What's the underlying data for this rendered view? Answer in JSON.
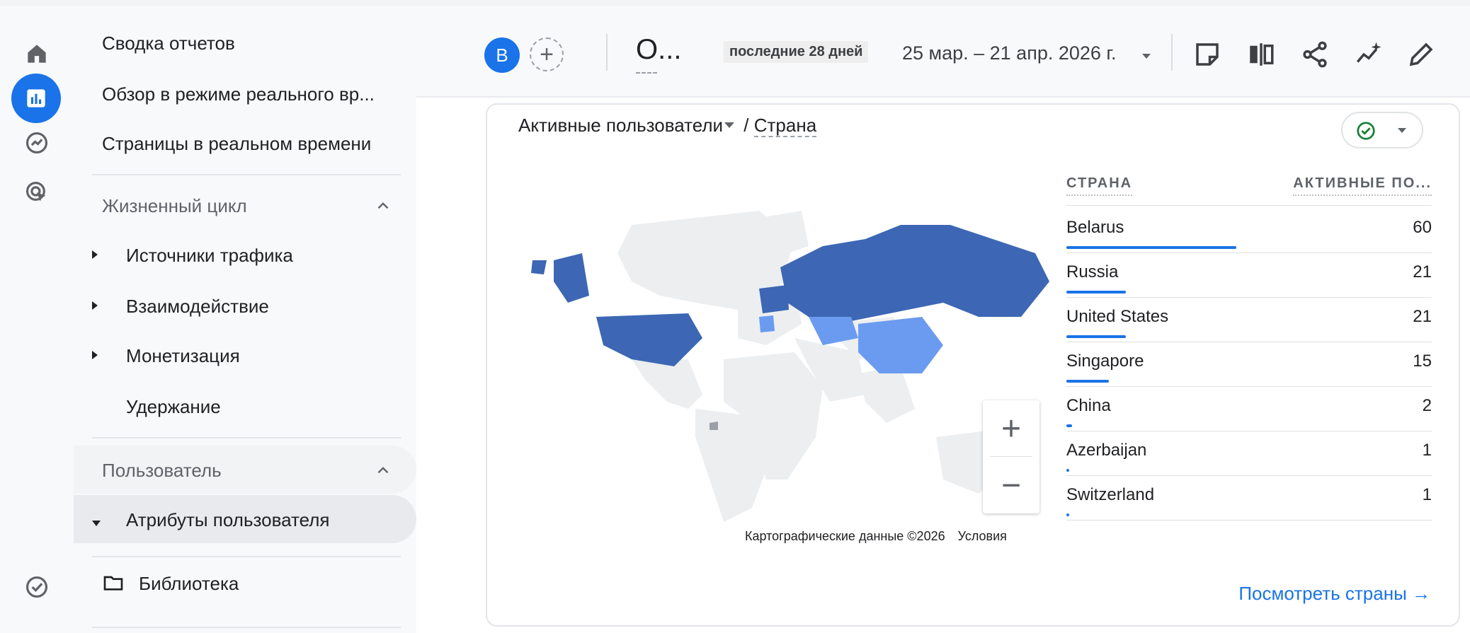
{
  "nav": {
    "reports_snapshot": "Сводка отчетов",
    "realtime_overview": "Обзор в режиме реального вр...",
    "realtime_pages": "Страницы в реальном времени",
    "lifecycle_section": "Жизненный цикл",
    "lifecycle_items": [
      "Источники трафика",
      "Взаимодействие",
      "Монетизация",
      "Удержание"
    ],
    "user_section": "Пользователь",
    "user_attributes": "Атрибуты пользователя",
    "library": "Библиотека"
  },
  "header": {
    "avatar_letter": "B",
    "add_symbol": "+",
    "comparison_label": "О...",
    "date_chip": "последние 28 дней",
    "date_range": "25 мар. – 21 апр. 2026 г."
  },
  "card": {
    "metric": "Активные пользователи",
    "separator": " / ",
    "dimension": "Страна",
    "map_attribution": "Картографические данные ©2026",
    "map_terms": "Условия",
    "zoom_in": "+",
    "zoom_out": "−",
    "see_more": "Посмотреть страны →"
  },
  "table": {
    "col_country": "СТРАНА",
    "col_active": "АКТИВНЫЕ ПО...",
    "rows": [
      {
        "country": "Belarus",
        "value": "60"
      },
      {
        "country": "Russia",
        "value": "21"
      },
      {
        "country": "United States",
        "value": "21"
      },
      {
        "country": "Singapore",
        "value": "15"
      },
      {
        "country": "China",
        "value": "2"
      },
      {
        "country": "Azerbaijan",
        "value": "1"
      },
      {
        "country": "Switzerland",
        "value": "1"
      }
    ]
  },
  "colors": {
    "accent": "#1a73e8",
    "map_dark": "#3d67b4",
    "map_light": "#6b9bf0",
    "map_land": "#eceef0"
  }
}
